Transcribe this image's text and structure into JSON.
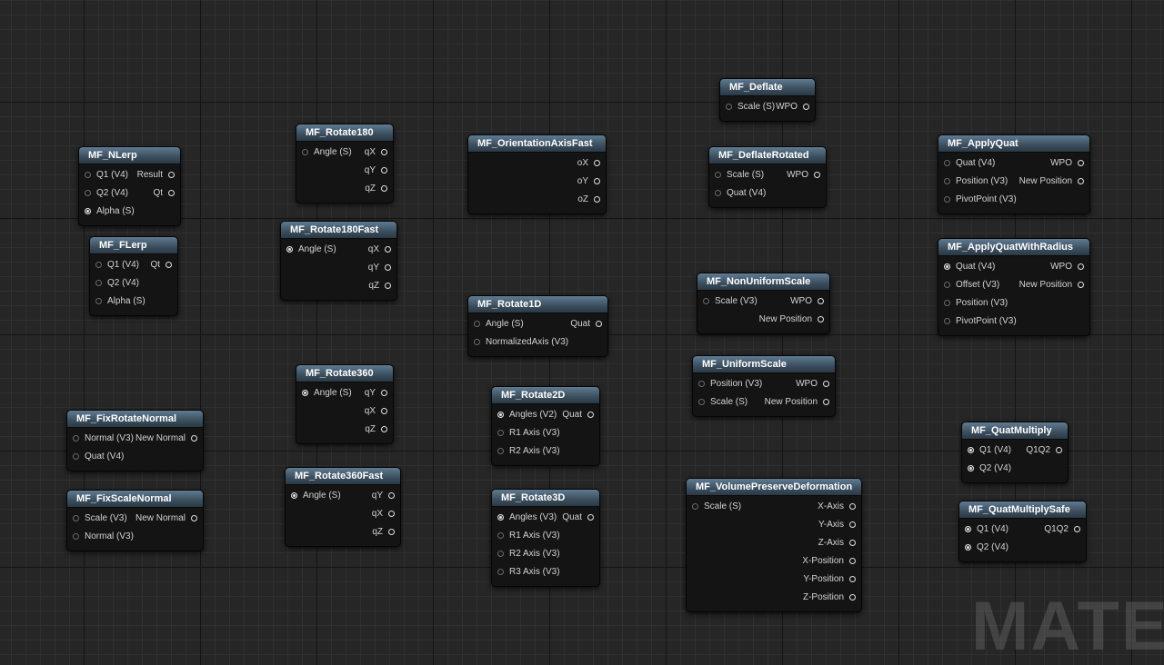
{
  "nodes": [
    {
      "id": "mf-nlerp",
      "title": "MF_NLerp",
      "rows": [
        {
          "in": "Q1 (V4)",
          "out": "Result"
        },
        {
          "in": "Q2 (V4)",
          "out": "Qt"
        },
        {
          "in": "Alpha (S)",
          "in_connected": true
        }
      ]
    },
    {
      "id": "mf-flerp",
      "title": "MF_FLerp",
      "rows": [
        {
          "in": "Q1 (V4)",
          "out": "Qt"
        },
        {
          "in": "Q2 (V4)"
        },
        {
          "in": "Alpha (S)"
        }
      ]
    },
    {
      "id": "mf-fixrotatenormal",
      "title": "MF_FixRotateNormal",
      "rows": [
        {
          "in": "Normal (V3)",
          "out": "New Normal"
        },
        {
          "in": "Quat (V4)"
        }
      ]
    },
    {
      "id": "mf-fixscalenormal",
      "title": "MF_FixScaleNormal",
      "rows": [
        {
          "in": "Scale (V3)",
          "out": "New Normal"
        },
        {
          "in": "Normal (V3)"
        }
      ]
    },
    {
      "id": "mf-rotate180",
      "title": "MF_Rotate180",
      "rows": [
        {
          "in": "Angle (S)",
          "out": "qX"
        },
        {
          "out": "qY"
        },
        {
          "out": "qZ"
        }
      ]
    },
    {
      "id": "mf-rotate180fast",
      "title": "MF_Rotate180Fast",
      "rows": [
        {
          "in": "Angle (S)",
          "in_connected": true,
          "out": "qX"
        },
        {
          "out": "qY"
        },
        {
          "out": "qZ"
        }
      ]
    },
    {
      "id": "mf-rotate360",
      "title": "MF_Rotate360",
      "rows": [
        {
          "in": "Angle (S)",
          "in_connected": true,
          "out": "qY"
        },
        {
          "out": "qX"
        },
        {
          "out": "qZ"
        }
      ]
    },
    {
      "id": "mf-rotate360fast",
      "title": "MF_Rotate360Fast",
      "rows": [
        {
          "in": "Angle (S)",
          "in_connected": true,
          "out": "qY"
        },
        {
          "out": "qX"
        },
        {
          "out": "qZ"
        }
      ]
    },
    {
      "id": "mf-orientationaxisfast",
      "title": "MF_OrientationAxisFast",
      "rows": [
        {
          "out": "oX"
        },
        {
          "out": "oY"
        },
        {
          "out": "oZ"
        }
      ]
    },
    {
      "id": "mf-rotate1d",
      "title": "MF_Rotate1D",
      "rows": [
        {
          "in": "Angle (S)",
          "out": "Quat"
        },
        {
          "in": "NormalizedAxis (V3)"
        }
      ]
    },
    {
      "id": "mf-rotate2d",
      "title": "MF_Rotate2D",
      "rows": [
        {
          "in": "Angles (V2)",
          "in_connected": true,
          "out": "Quat"
        },
        {
          "in": "R1 Axis (V3)"
        },
        {
          "in": "R2 Axis (V3)"
        }
      ]
    },
    {
      "id": "mf-rotate3d",
      "title": "MF_Rotate3D",
      "rows": [
        {
          "in": "Angles (V3)",
          "in_connected": true,
          "out": "Quat"
        },
        {
          "in": "R1 Axis (V3)"
        },
        {
          "in": "R2 Axis (V3)"
        },
        {
          "in": "R3 Axis (V3)"
        }
      ]
    },
    {
      "id": "mf-deflate",
      "title": "MF_Deflate",
      "rows": [
        {
          "in": "Scale (S)",
          "out": "WPO"
        }
      ]
    },
    {
      "id": "mf-deflaterotated",
      "title": "MF_DeflateRotated",
      "rows": [
        {
          "in": "Scale (S)",
          "out": "WPO"
        },
        {
          "in": "Quat (V4)"
        }
      ]
    },
    {
      "id": "mf-nonuniformscale",
      "title": "MF_NonUniformScale",
      "rows": [
        {
          "in": "Scale (V3)",
          "out": "WPO"
        },
        {
          "out": "New Position"
        }
      ]
    },
    {
      "id": "mf-uniformscale",
      "title": "MF_UniformScale",
      "rows": [
        {
          "in": "Position (V3)",
          "out": "WPO"
        },
        {
          "in": "Scale (S)",
          "out": "New Position"
        }
      ]
    },
    {
      "id": "mf-volumepreservedeformation",
      "title": "MF_VolumePreserveDeformation",
      "rows": [
        {
          "in": "Scale (S)",
          "out": "X-Axis"
        },
        {
          "out": "Y-Axis"
        },
        {
          "out": "Z-Axis"
        },
        {
          "out": "X-Position"
        },
        {
          "out": "Y-Position"
        },
        {
          "out": "Z-Position"
        }
      ]
    },
    {
      "id": "mf-applyquat",
      "title": "MF_ApplyQuat",
      "rows": [
        {
          "in": "Quat (V4)",
          "out": "WPO"
        },
        {
          "in": "Position (V3)",
          "out": "New Position"
        },
        {
          "in": "PivotPoint (V3)"
        }
      ]
    },
    {
      "id": "mf-applyquatwithradius",
      "title": "MF_ApplyQuatWithRadius",
      "rows": [
        {
          "in": "Quat (V4)",
          "in_connected": true,
          "out": "WPO"
        },
        {
          "in": "Offset (V3)",
          "out": "New Position"
        },
        {
          "in": "Position (V3)"
        },
        {
          "in": "PivotPoint (V3)"
        }
      ]
    },
    {
      "id": "mf-quatmultiply",
      "title": "MF_QuatMultiply",
      "rows": [
        {
          "in": "Q1 (V4)",
          "in_connected": true,
          "out": "Q1Q2"
        },
        {
          "in": "Q2 (V4)",
          "in_connected": true
        }
      ]
    },
    {
      "id": "mf-quatmultiplysafe",
      "title": "MF_QuatMultiplySafe",
      "rows": [
        {
          "in": "Q1 (V4)",
          "in_connected": true,
          "out": "Q1Q2"
        },
        {
          "in": "Q2 (V4)",
          "in_connected": true
        }
      ]
    }
  ],
  "watermark": "MATERI"
}
